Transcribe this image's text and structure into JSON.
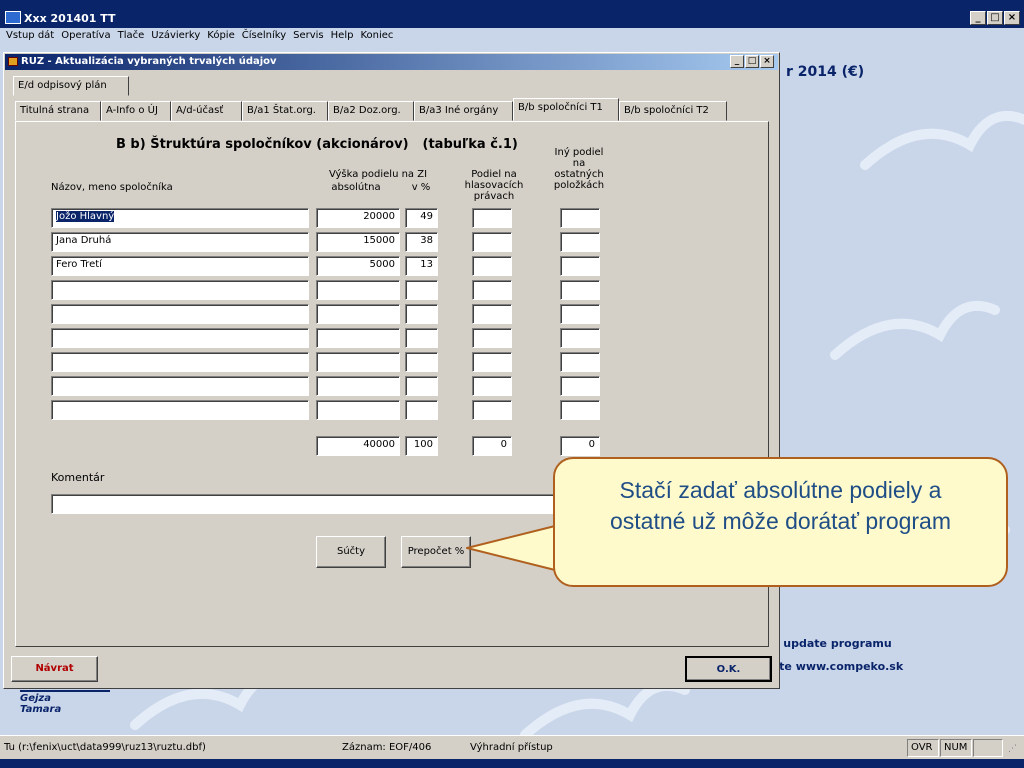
{
  "window": {
    "title": "Xxx 201401 TT"
  },
  "menu": [
    "Vstup dát",
    "Operatíva",
    "Tlače",
    "Uzávierky",
    "Kópie",
    "Číselníky",
    "Servis",
    "Help",
    "Koniec"
  ],
  "background": {
    "heading": "r 2014 (€)",
    "line1": "e update programu",
    "line2": "vte www.compeko.sk",
    "names": [
      "Gejza",
      "Tamara"
    ]
  },
  "dialog": {
    "title": "RUZ - Aktualizácia vybraných trvalých údajov",
    "top_tab": "E/d odpisový plán",
    "tabs": [
      "Titulná strana",
      "A-Info o ÚJ",
      "A/d-účasť",
      "B/a1 Štat.org.",
      "B/a2 Doz.org.",
      "B/a3 Iné orgány",
      "B/b spoločníci T1",
      "B/b spoločníci T2"
    ],
    "active_tab": "B/b spoločníci T1",
    "section_title": "B  b) Štruktúra spoločníkov (akcionárov)",
    "section_sub": "(tabuľka č.1)",
    "headers": {
      "name": "Názov, meno spoločníka",
      "share_group": "Výška podielu na ZI",
      "absolute": "absolútna",
      "percent": "v %",
      "voting": [
        "Podiel na",
        "hlasovacích",
        "právach"
      ],
      "other": [
        "Iný podiel",
        "na",
        "ostatných",
        "položkách"
      ]
    },
    "rows": [
      {
        "name": "Jožo Hlavný",
        "absolute": "20000",
        "percent": "49",
        "voting": "",
        "other": ""
      },
      {
        "name": "Jana Druhá",
        "absolute": "15000",
        "percent": "38",
        "voting": "",
        "other": ""
      },
      {
        "name": "Fero Tretí",
        "absolute": "5000",
        "percent": "13",
        "voting": "",
        "other": ""
      },
      {
        "name": "",
        "absolute": "",
        "percent": "",
        "voting": "",
        "other": ""
      },
      {
        "name": "",
        "absolute": "",
        "percent": "",
        "voting": "",
        "other": ""
      },
      {
        "name": "",
        "absolute": "",
        "percent": "",
        "voting": "",
        "other": ""
      },
      {
        "name": "",
        "absolute": "",
        "percent": "",
        "voting": "",
        "other": ""
      },
      {
        "name": "",
        "absolute": "",
        "percent": "",
        "voting": "",
        "other": ""
      },
      {
        "name": "",
        "absolute": "",
        "percent": "",
        "voting": "",
        "other": ""
      }
    ],
    "totals": {
      "absolute": "40000",
      "percent": "100",
      "voting": "0",
      "other": "0"
    },
    "comment_label": "Komentár",
    "comment_value": "",
    "sum_button": "Súčty",
    "recalc_button": "Prepočet %",
    "back_button": "Návrat",
    "ok_button": "O.K."
  },
  "callout": {
    "line1": "Stačí zadať absolútne podiely a",
    "line2": "ostatné už môže dorátať program"
  },
  "status": {
    "path": "Tu (r:\\fenix\\uct\\data999\\ruz13\\ruztu.dbf)",
    "record": "Záznam: EOF/406",
    "access": "Výhradní přístup",
    "ovr": "OVR",
    "num": "NUM"
  },
  "colors": {
    "titlebar": "#0a246a",
    "dialog_face": "#d4d0c8",
    "callout_bg": "#fffacc",
    "callout_border": "#b0601e",
    "callout_text": "#1f4e86",
    "back_text": "#b00000"
  }
}
